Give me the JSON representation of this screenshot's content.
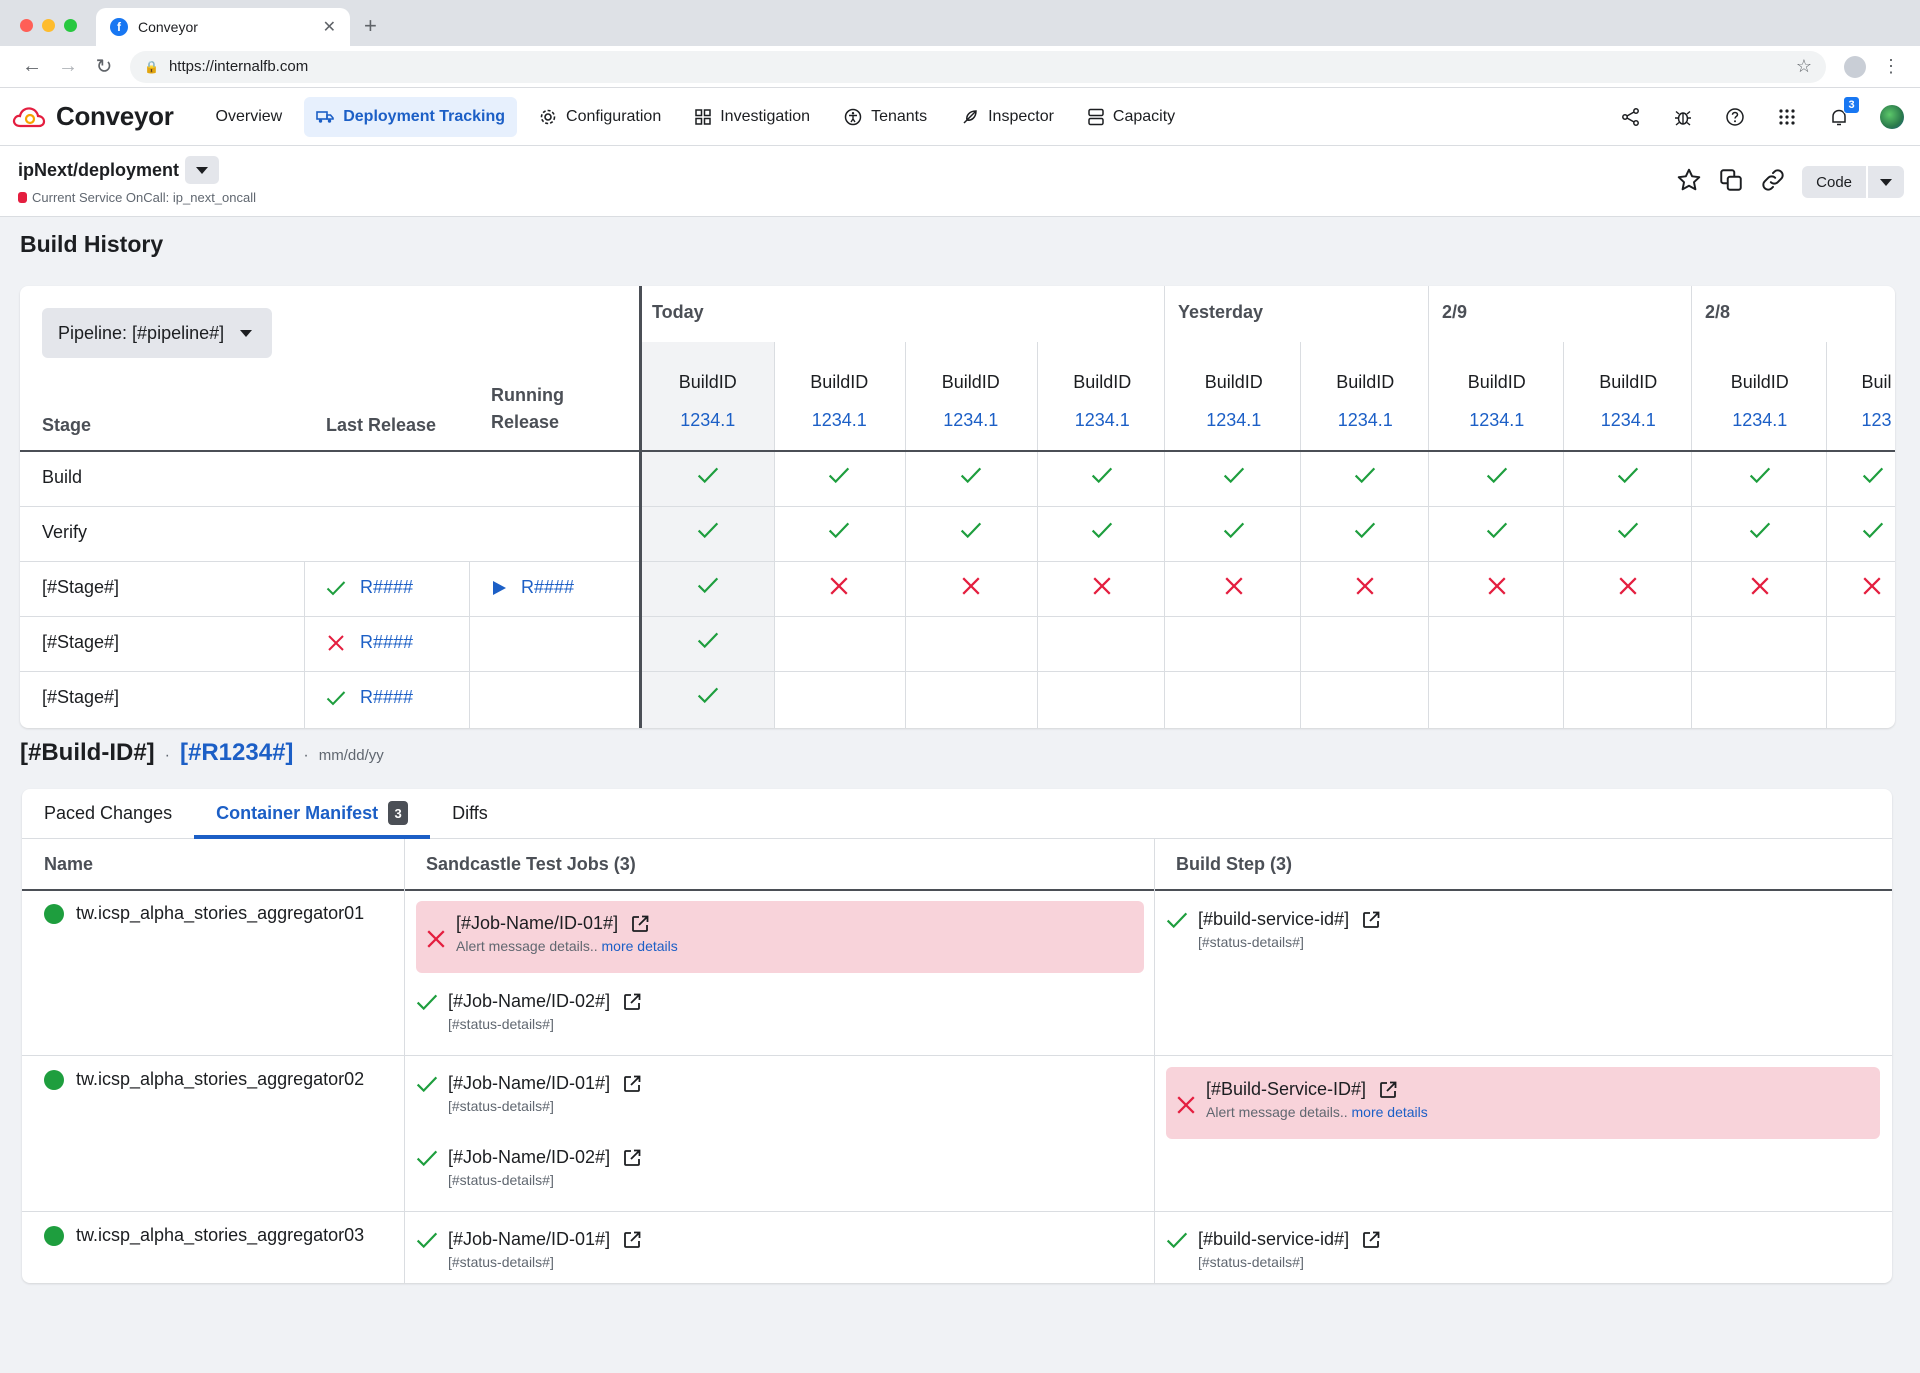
{
  "browser": {
    "tab_title": "Conveyor",
    "url": "https://internalfb.com"
  },
  "app": {
    "name": "Conveyor",
    "nav": [
      {
        "label": "Overview",
        "icon": "none"
      },
      {
        "label": "Deployment Tracking",
        "icon": "truck-icon",
        "active": true
      },
      {
        "label": "Configuration",
        "icon": "gear-icon"
      },
      {
        "label": "Investigation",
        "icon": "grid-icon"
      },
      {
        "label": "Tenants",
        "icon": "accessibility-icon"
      },
      {
        "label": "Inspector",
        "icon": "feather-icon"
      },
      {
        "label": "Capacity",
        "icon": "server-icon"
      }
    ],
    "notification_count": "3"
  },
  "context": {
    "title": "ipNext/deployment",
    "oncall": "Current Service OnCall: ip_next_oncall",
    "code_label": "Code"
  },
  "build_history": {
    "title": "Build History",
    "pipeline_label": "Pipeline: [#pipeline#]",
    "headers": {
      "stage": "Stage",
      "last_release": "Last Release",
      "running_release_1": "Running",
      "running_release_2": "Release"
    },
    "date_groups": [
      "Today",
      "Yesterday",
      "2/9",
      "2/8"
    ],
    "build_label": "BuildID",
    "build_number": "1234.1",
    "build_number_partial": "123",
    "build_label_partial": "Buil",
    "stages": [
      {
        "name": "Build",
        "last": "",
        "running": ""
      },
      {
        "name": "Verify",
        "last": "",
        "running": ""
      },
      {
        "name": "[#Stage#]",
        "last": "R####",
        "last_status": "success",
        "running": "R####"
      },
      {
        "name": "[#Stage#]",
        "last": "R####",
        "last_status": "failed",
        "running": ""
      },
      {
        "name": "[#Stage#]",
        "last": "R####",
        "last_status": "success",
        "running": ""
      }
    ]
  },
  "build_detail": {
    "build_id": "[#Build-ID#]",
    "release": "[#R1234#]",
    "date": "mm/dd/yy",
    "tabs": [
      "Paced Changes",
      "Container Manifest",
      "Diffs"
    ],
    "active_tab_count": "3",
    "columns": [
      "Name",
      "Sandcastle Test Jobs (3)",
      "Build Step (3)"
    ],
    "rows": [
      {
        "name": "tw.icsp_alpha_stories_aggregator01",
        "jobs": [
          {
            "name": "[#Job-Name/ID-01#]",
            "status": "failed",
            "detail": "Alert message details..",
            "more": "more details"
          },
          {
            "name": "[#Job-Name/ID-02#]",
            "status": "success",
            "detail": "[#status-details#]"
          }
        ],
        "build": {
          "name": "[#build-service-id#]",
          "status": "success",
          "detail": "[#status-details#]"
        }
      },
      {
        "name": "tw.icsp_alpha_stories_aggregator02",
        "jobs": [
          {
            "name": "[#Job-Name/ID-01#]",
            "status": "success",
            "detail": "[#status-details#]"
          },
          {
            "name": "[#Job-Name/ID-02#]",
            "status": "success",
            "detail": "[#status-details#]"
          }
        ],
        "build": {
          "name": "[#Build-Service-ID#]",
          "status": "failed",
          "detail": "Alert message details..",
          "more": "more details"
        }
      },
      {
        "name": "tw.icsp_alpha_stories_aggregator03",
        "jobs": [
          {
            "name": "[#Job-Name/ID-01#]",
            "status": "success",
            "detail": "[#status-details#]"
          }
        ],
        "build": {
          "name": "[#build-service-id#]",
          "status": "success",
          "detail": "[#status-details#]"
        }
      }
    ]
  },
  "colors": {
    "accent": "#1c5fc6",
    "success": "#1e9e3e",
    "failure": "#e41e3f",
    "alert_bg": "#f8d3da"
  }
}
